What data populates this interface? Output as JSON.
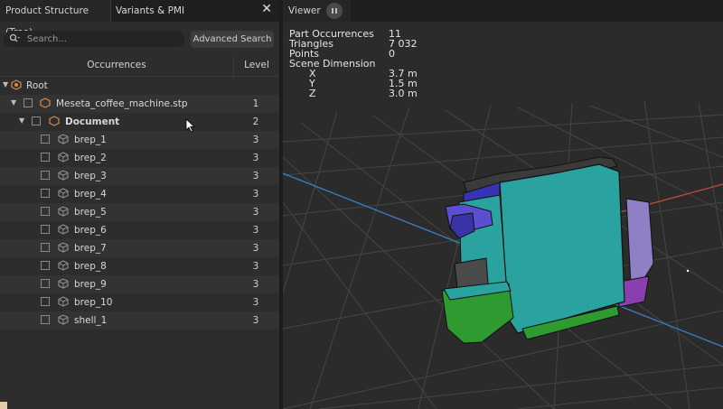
{
  "left_panel": {
    "tabs": [
      {
        "label": "Product Structure (Tree)"
      },
      {
        "label": "Variants & PMI"
      }
    ],
    "close_glyph": "✕",
    "search": {
      "placeholder": "Search..."
    },
    "advanced_search_label": "Advanced Search",
    "columns": {
      "occurrences": "Occurrences",
      "level": "Level"
    },
    "rows": [
      {
        "label": "Root",
        "level": ""
      },
      {
        "label": "Meseta_coffee_machine.stp",
        "level": "1"
      },
      {
        "label": "Document",
        "level": "2"
      },
      {
        "label": "brep_1",
        "level": "3"
      },
      {
        "label": "brep_2",
        "level": "3"
      },
      {
        "label": "brep_3",
        "level": "3"
      },
      {
        "label": "brep_4",
        "level": "3"
      },
      {
        "label": "brep_5",
        "level": "3"
      },
      {
        "label": "brep_6",
        "level": "3"
      },
      {
        "label": "brep_7",
        "level": "3"
      },
      {
        "label": "brep_8",
        "level": "3"
      },
      {
        "label": "brep_9",
        "level": "3"
      },
      {
        "label": "brep_10",
        "level": "3"
      },
      {
        "label": "shell_1",
        "level": "3"
      }
    ]
  },
  "viewer": {
    "tab_label": "Viewer",
    "stats": {
      "part_occurrences_label": "Part Occurrences",
      "part_occurrences_value": "11",
      "triangles_label": "Triangles",
      "triangles_value": "7 032",
      "points_label": "Points",
      "points_value": "0",
      "scene_dimension_label": "Scene Dimension",
      "x_label": "X",
      "x_value": "3.7 m",
      "y_label": "Y",
      "y_value": "1.5 m",
      "z_label": "Z",
      "z_value": "3.0 m"
    }
  },
  "colors": {
    "machine_body": "#2aa3a0",
    "top_cap": "#3a3a3a",
    "portafilter": "#5b4fd0",
    "drip_tray": "#2f9a2f",
    "side_panel": "#8f7fc5",
    "axis_red": "#c04a3a",
    "axis_blue": "#3b7fc8"
  }
}
